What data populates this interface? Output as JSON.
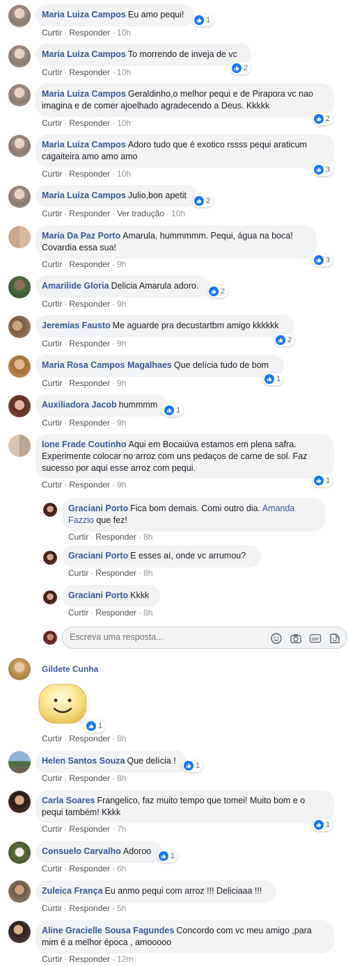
{
  "actions": {
    "like": "Curtir",
    "reply": "Responder",
    "translate": "Ver tradução"
  },
  "colors": {
    "author": "#385898",
    "bubble": "#f2f3f5",
    "like": "#1877f2"
  },
  "comments": [
    {
      "author": "Maria Luiza Campos",
      "text": "Eu amo pequi!",
      "time": "10h",
      "reactions": "1"
    },
    {
      "author": "Maria Luiza Campos",
      "text": "To morrendo de inveja de vc",
      "time": "10h",
      "reactions": "2"
    },
    {
      "author": "Maria Luiza Campos",
      "line1": "Geraldinho,o melhor pequi e de Pirapora vc nao",
      "line2": "imagina e de comer ajoelhado agradecendo a Deus. Kkkkk",
      "time": "10h",
      "reactions": "2"
    },
    {
      "author": "Maria Luiza Campos",
      "line1": "Adoro tudo que é exotico rssss pequi araticum",
      "line2": "cagaiteira amo amo amo",
      "time": "10h",
      "reactions": "3"
    },
    {
      "author": "Maria Luiza Campos",
      "text": "Julio,bon apetit",
      "time": "10h",
      "reactions": "2"
    },
    {
      "author": "Maria Da Paz Porto",
      "line1": "Amarula, hummmmm. Pequi, água na boca!",
      "line2": "Covardia essa sua!",
      "time": "9h",
      "reactions": "3"
    },
    {
      "author": "Amarilide Gloria",
      "text": "Delicia Amarula adoro.",
      "time": "9h",
      "reactions": "2"
    },
    {
      "author": "Jeremias Fausto",
      "text": "Me aguarde pra decustartbm amigo kkkkkk",
      "time": "9h",
      "reactions": "2"
    },
    {
      "author": "Maria Rosa Campos Magalhaes",
      "text": "Que delícia tudo de bom",
      "time": "9h",
      "reactions": "1"
    },
    {
      "author": "Auxiliadora Jacob",
      "text": "hummmm",
      "time": "9h",
      "reactions": "1"
    },
    {
      "author": "Ione Frade Coutinho",
      "line1": "Aqui em Bocaiúva estamos em plena safra.",
      "line2": "Experimente colocar no arroz com uns pedaços de carne de sol. Faz",
      "line3": "sucesso por aqui esse arroz com pequi.",
      "time": "9h",
      "reactions": "1"
    }
  ],
  "replies": [
    {
      "author": "Graciani Porto",
      "text": "Fica bom demais. Comi outro dia.",
      "mention1": "Amanda",
      "mention2": "Fazzio",
      "text2": "que fez!",
      "time": "8h"
    },
    {
      "author": "Graciani Porto",
      "text": "E esses aí, onde vc arrumou?",
      "time": "8h"
    },
    {
      "author": "Graciani Porto",
      "text": "Kkkk",
      "time": "8h"
    }
  ],
  "reply_box": {
    "placeholder": "Escreva uma resposta..."
  },
  "later_comments": [
    {
      "author": "Gildete Cunha",
      "time": "8h",
      "reactions": "1"
    },
    {
      "author": "Helen Santos Souza",
      "text": "Que delícia !",
      "time": "8h",
      "reactions": "1"
    },
    {
      "author": "Carla Soares",
      "line1": "Frangelico, faz muito tempo que tomei! Muito bom e o",
      "line2": "pequi também! Kkkk",
      "time": "7h",
      "reactions": "1"
    },
    {
      "author": "Consuelo Carvalho",
      "text": "Adoroo",
      "time": "6h",
      "reactions": "1"
    },
    {
      "author": "Zuleica França",
      "text": "Eu anmo pequi com arroz !!! Deliciaaa !!!",
      "time": "5h"
    },
    {
      "author": "Aline Gracielle Sousa Fagundes",
      "line1": "Concordo com vc meu amigo ,para",
      "line2": "mim é a melhor época , amooooo",
      "time": "12m"
    }
  ]
}
